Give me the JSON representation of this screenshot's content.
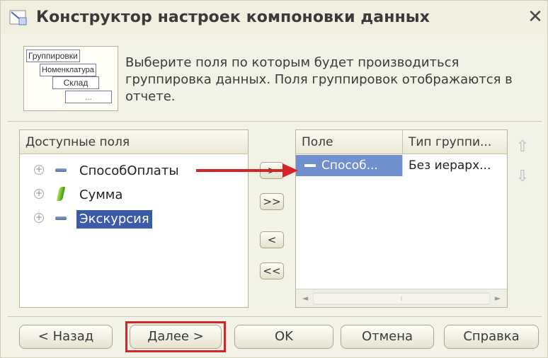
{
  "window": {
    "title": "Конструктор настроек компоновки данных",
    "close_symbol": "✕"
  },
  "info": {
    "picture": {
      "level1": "Группировки",
      "level2": "Номенклатура",
      "level3": "Склад",
      "level4": "..."
    },
    "text": "Выберите поля по которым будет производиться группировка данных. Поля группировок отображаются в отчете."
  },
  "available": {
    "header": "Доступные поля",
    "items": [
      {
        "label": "СпособОплаты",
        "icon": "dimension-icon",
        "expand": "+",
        "selected": false
      },
      {
        "label": "Сумма",
        "icon": "resource-icon",
        "expand": "+",
        "selected": false
      },
      {
        "label": "Экскурсия",
        "icon": "dimension-icon",
        "expand": "+",
        "selected": true
      }
    ]
  },
  "transfer": {
    "add": ">",
    "add_all": ">>",
    "remove": "<",
    "remove_all": "<<"
  },
  "groupings": {
    "columns": [
      "Поле",
      "Тип группи..."
    ],
    "rows": [
      {
        "field": "Способ...",
        "type": "Без иерарх..."
      }
    ]
  },
  "scrollbar": {
    "left": "◄",
    "right": "►"
  },
  "order": {
    "up": "⇧",
    "down": "⇩"
  },
  "buttons": {
    "back": "< Назад",
    "next": "Далее >",
    "ok": "OK",
    "cancel": "Отмена",
    "help": "Справка"
  },
  "colors": {
    "selection": "#3c5aaa",
    "row_selection": "#6f8fce",
    "highlight": "#d8222a",
    "arrow": "#d8222a"
  }
}
